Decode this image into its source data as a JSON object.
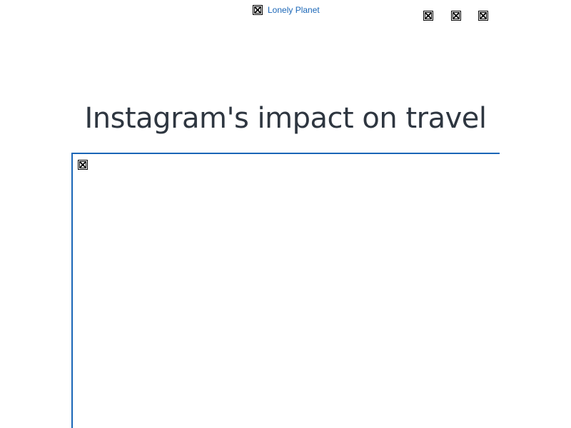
{
  "header": {
    "logo_alt": "Lonely Planet",
    "logo_icon": "broken-image-icon",
    "utility_icons": [
      "broken-image-icon",
      "broken-image-icon",
      "broken-image-icon"
    ]
  },
  "article": {
    "title": "Instagram's impact on travel",
    "hero_icon": "broken-image-icon"
  },
  "colors": {
    "link": "#1a66b7",
    "title": "#2e3640",
    "accent_border": "#1a66b7"
  }
}
